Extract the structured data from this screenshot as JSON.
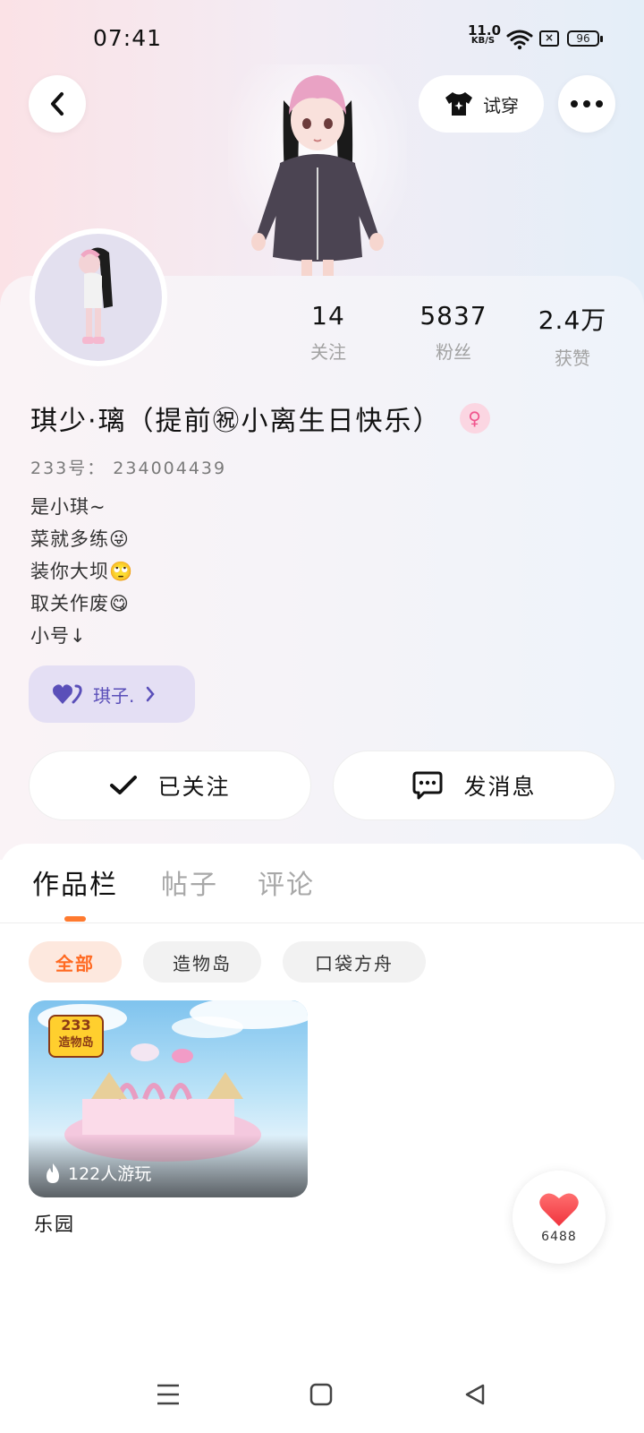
{
  "status_bar": {
    "time": "07:41",
    "net_speed_value": "11.0",
    "net_speed_unit": "KB/S",
    "battery": "96"
  },
  "header": {
    "tryon_label": "试穿"
  },
  "profile": {
    "stats": [
      {
        "value": "14",
        "label": "关注"
      },
      {
        "value": "5837",
        "label": "粉丝"
      },
      {
        "value": "2.4万",
        "label": "获赞"
      }
    ],
    "name": "琪少·璃（提前㊗小离生日快乐）",
    "gender_symbol": "♀",
    "uid_line": "233号：  234004439",
    "bio_lines": [
      "是小琪~",
      "菜就多练😜",
      "装你大坝🙄",
      "取关作废😋",
      "小号↓"
    ],
    "linked_account": "琪子."
  },
  "actions": {
    "follow_label": "已关注",
    "message_label": "发消息"
  },
  "tabs": [
    {
      "label": "作品栏",
      "active": true
    },
    {
      "label": "帖子",
      "active": false
    },
    {
      "label": "评论",
      "active": false
    }
  ],
  "filters": [
    {
      "label": "全部",
      "active": true
    },
    {
      "label": "造物岛",
      "active": false
    },
    {
      "label": "口袋方舟",
      "active": false
    }
  ],
  "works": [
    {
      "badge_top": "233",
      "badge_bottom": "造物岛",
      "plays": "122人游玩",
      "title": "乐园"
    }
  ],
  "like_fab": {
    "count": "6488"
  },
  "colors": {
    "accent_orange": "#ff7a2f",
    "tag_purple": "#5a4fb9",
    "heart_red": "#f0343e"
  }
}
